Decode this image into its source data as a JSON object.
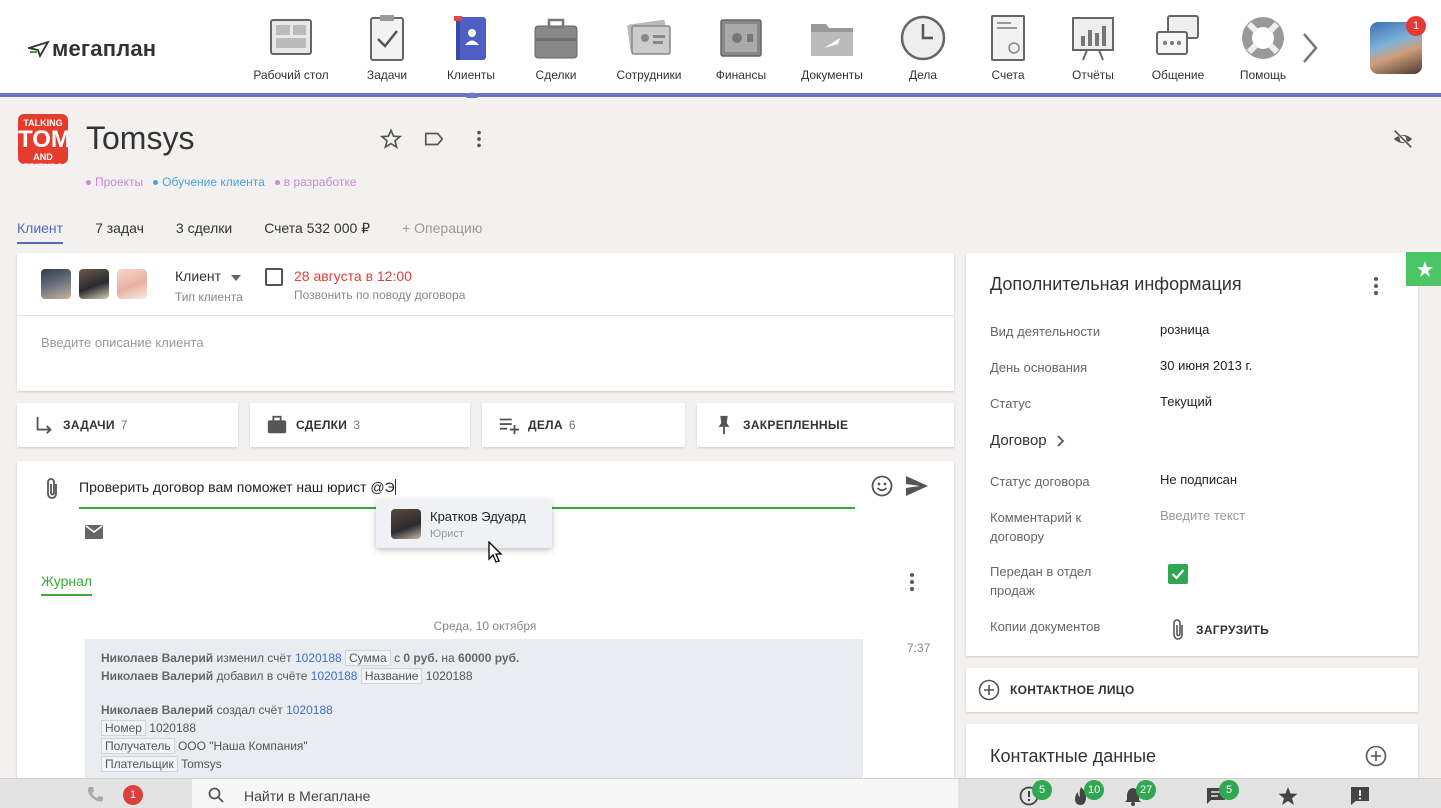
{
  "app": {
    "name": "мегаплан"
  },
  "nav": [
    {
      "label": "Рабочий стол",
      "icon": "desktop-icon"
    },
    {
      "label": "Задачи",
      "icon": "tasks-icon"
    },
    {
      "label": "Клиенты",
      "icon": "clients-icon",
      "active": true
    },
    {
      "label": "Сделки",
      "icon": "briefcase-icon"
    },
    {
      "label": "Сотрудники",
      "icon": "employees-icon"
    },
    {
      "label": "Финансы",
      "icon": "safe-icon"
    },
    {
      "label": "Документы",
      "icon": "folder-icon"
    },
    {
      "label": "Дела",
      "icon": "clock-icon"
    },
    {
      "label": "Счета",
      "icon": "invoice-icon"
    },
    {
      "label": "Отчёты",
      "icon": "chart-board-icon"
    },
    {
      "label": "Общение",
      "icon": "chat-icon"
    },
    {
      "label": "Помощь",
      "icon": "lifebuoy-icon"
    }
  ],
  "user": {
    "notifications": "1"
  },
  "client": {
    "logo_lines": [
      "TALKING",
      "TOM",
      "AND FRIENDS"
    ],
    "name": "Tomsys",
    "tags": [
      {
        "label": "Проекты",
        "color": "#c98bd6"
      },
      {
        "label": "Обучение клиента",
        "color": "#4aa3df"
      },
      {
        "label": "в разработке",
        "color": "#c98bd6"
      }
    ]
  },
  "tabs": [
    {
      "label": "Клиент",
      "active": true
    },
    {
      "label": "7 задач"
    },
    {
      "label": "3 сделки"
    },
    {
      "label": "Счета 532 000 ₽"
    },
    {
      "label": "+ Операцию",
      "muted": true
    }
  ],
  "summary": {
    "client_type": "Клиент",
    "client_type_label": "Тип клиента",
    "task_date": "28 августа в 12:00",
    "task_desc": "Позвонить по поводу договора",
    "description_placeholder": "Введите описание клиента"
  },
  "sections": [
    {
      "label": "ЗАДАЧИ",
      "count": "7",
      "icon": "subtask-arrow-icon"
    },
    {
      "label": "СДЕЛКИ",
      "count": "3",
      "icon": "briefcase-icon"
    },
    {
      "label": "ДЕЛА",
      "count": "6",
      "icon": "playlist-add-icon"
    },
    {
      "label": "ЗАКРЕПЛЕННЫЕ",
      "count": "",
      "icon": "pin-icon"
    }
  ],
  "composer": {
    "text": "Проверить договор вам поможет наш юрист @Э"
  },
  "mention": {
    "name": "Кратков Эдуард",
    "role": "Юрист"
  },
  "journal": {
    "tab": "Журнал",
    "date": "Среда, 10 октября",
    "time": "7:37",
    "entries": {
      "e1_author": "Николаев Валерий",
      "e1_action": "изменил счёт",
      "e1_link": "1020188",
      "e1_field": "Сумма",
      "e1_from": "с",
      "e1_old": "0 руб.",
      "e1_to": "на",
      "e1_new": "60000 руб.",
      "e2_author": "Николаев Валерий",
      "e2_action": "добавил в счёте",
      "e2_link": "1020188",
      "e2_field": "Название",
      "e2_value": "1020188",
      "e3_author": "Николаев Валерий",
      "e3_action": "создал счёт",
      "e3_link": "1020188",
      "f1_label": "Номер",
      "f1_value": "1020188",
      "f2_label": "Получатель",
      "f2_value": "ООО \"Наша Компания\"",
      "f3_label": "Плательщик",
      "f3_value": "Tomsys"
    }
  },
  "extra": {
    "title": "Дополнительная информация",
    "rows": [
      {
        "label": "Вид деятельности",
        "value": "розница"
      },
      {
        "label": "День основания",
        "value": "30 июня 2013 г."
      },
      {
        "label": "Статус",
        "value": "Текущий"
      }
    ],
    "contract_header": "Договор",
    "contract_status_label": "Статус договора",
    "contract_status_value": "Не подписан",
    "comment_label": "Комментарий к договору",
    "comment_placeholder": "Введите текст",
    "sales_label": "Передан в отдел продаж",
    "sales_checked": true,
    "docs_label": "Копии документов",
    "upload_label": "ЗАГРУЗИТЬ"
  },
  "contact_person": {
    "label": "КОНТАКТНОЕ ЛИЦО"
  },
  "contact_data": {
    "title": "Контактные данные"
  },
  "bottombar": {
    "missed_calls": "1",
    "search_placeholder": "Найти в Мегаплане",
    "counters": [
      {
        "icon": "alert-circle-icon",
        "count": "5"
      },
      {
        "icon": "fire-icon",
        "count": "10"
      },
      {
        "icon": "bell-icon",
        "count": "27"
      },
      {
        "icon": "message-icon",
        "count": "5"
      },
      {
        "icon": "star-icon",
        "count": ""
      },
      {
        "icon": "feedback-icon",
        "count": ""
      }
    ]
  },
  "colors": {
    "accent": "#6f74c6",
    "green": "#3aa83a",
    "red": "#e2403b",
    "link": "#3d72c4"
  }
}
